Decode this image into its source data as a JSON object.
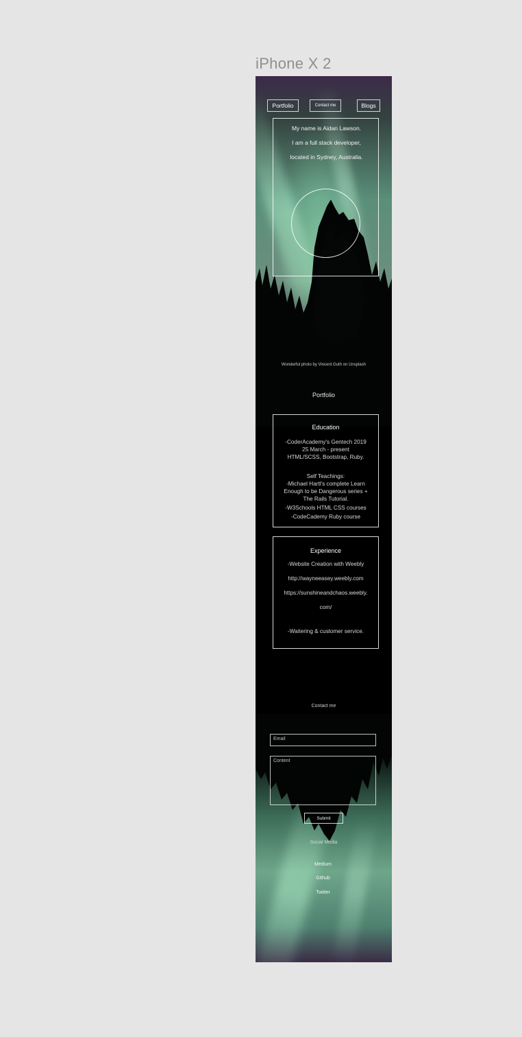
{
  "frame": {
    "title": "iPhone X 2"
  },
  "nav": {
    "portfolio": "Portfolio",
    "contact": "Contact me",
    "blogs": "Blogs"
  },
  "hero": {
    "line1": "My name is Aidan Lawson.",
    "line2": "I am a full stack developer,",
    "line3": "located in Sydney, Australia."
  },
  "credit": "Wonderful photo by Vincent Guth on Unsplash",
  "portfolio": {
    "heading": "Portfolio"
  },
  "education": {
    "title": "Education",
    "lines": [
      "-CoderAcademy's Gentech 2019",
      "25 March - present",
      "HTML/SCSS, Bootstrap, Ruby.",
      "Self Teachings:",
      "-Michael Hartl's complete Learn",
      "Enough to be Dangerous series +",
      "The Rails Tutorial.",
      "-W3Schools HTML CSS courses",
      "-CodeCademy Ruby course"
    ]
  },
  "experience": {
    "title": "Experience",
    "lines": [
      "-Website Creation with Weebly",
      "http://wayneeasey.weebly.com",
      "https://sunshineandchaos.weebly.",
      "com/",
      "-Waitering & customer service."
    ]
  },
  "contact": {
    "heading": "Contact me",
    "email_placeholder": "Email",
    "message_placeholder": "Content",
    "submit": "Submit"
  },
  "social": {
    "heading": "Social Media",
    "links": [
      "Medium",
      "Github",
      "Twitter"
    ]
  }
}
